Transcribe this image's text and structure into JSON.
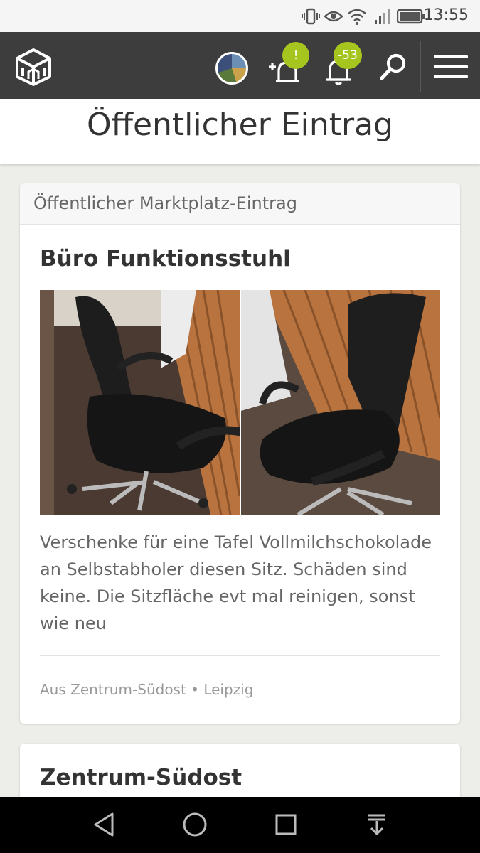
{
  "status_bar": {
    "time": "13:55"
  },
  "header": {
    "badge_add": "!",
    "badge_notifications": "-53"
  },
  "page": {
    "title": "Öffentlicher Eintrag"
  },
  "listing": {
    "section_label": "Öffentlicher Marktplatz-Eintrag",
    "title": "Büro Funktionsstuhl",
    "description": "Verschenke für eine Tafel Vollmilchschokolade an Selbstabholer diesen Sitz. Schäden sind keine. Die Sitzfläche evt mal reinigen, sonst wie neu",
    "meta": "Aus Zentrum-Südost • Leipzig"
  },
  "next_card": {
    "title": "Zentrum-Südost"
  },
  "icons": {
    "logo": "cube-house-logo",
    "add_notification": "bell-plus-icon",
    "notifications": "bell-icon",
    "search": "search-icon",
    "menu": "hamburger-menu-icon"
  },
  "colors": {
    "header_bg": "#3d3d3d",
    "badge": "#a6c51f",
    "background": "#ededea"
  }
}
